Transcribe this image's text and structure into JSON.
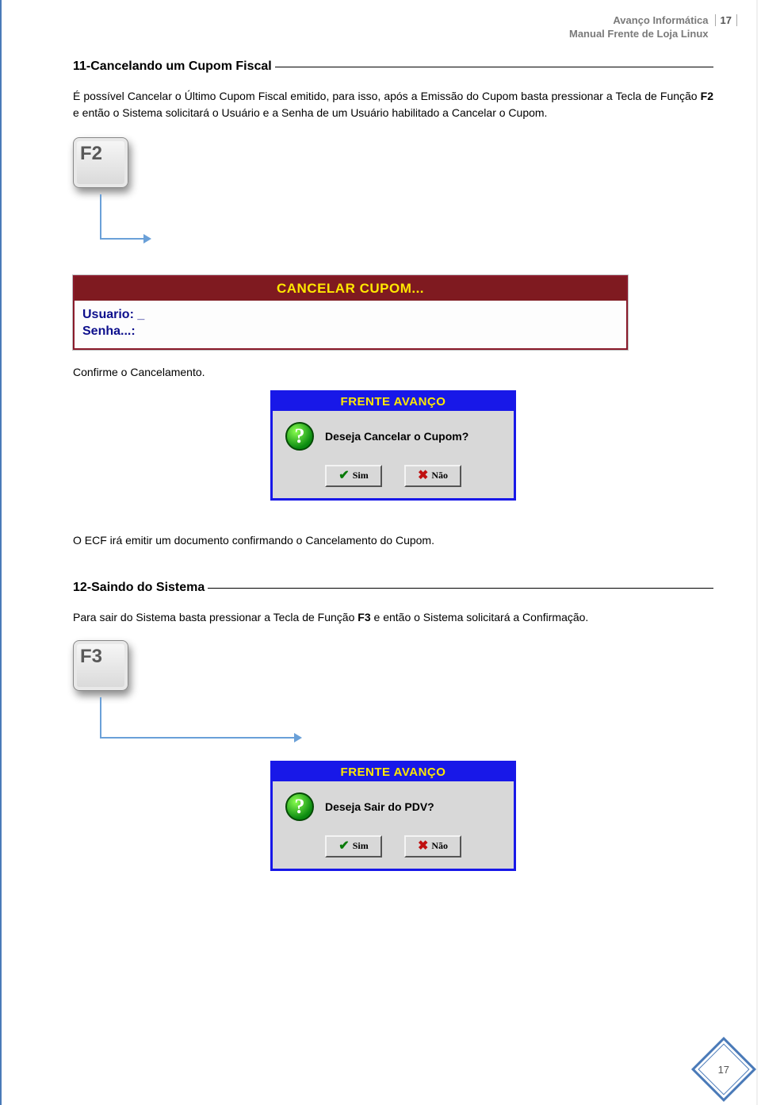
{
  "header": {
    "line1": "Avanço Informática",
    "line2": "Manual Frente de Loja Linux",
    "page_top": "17"
  },
  "section11": {
    "title": "11-Cancelando um Cupom Fiscal",
    "para1_a": "É possível Cancelar o Último Cupom Fiscal emitido, para isso, após a Emissão do Cupom basta pressionar a Tecla de Função ",
    "key_bold": "F2",
    "para1_b": " e então o Sistema solicitará o Usuário e a Senha de um Usuário habilitado a Cancelar o Cupom."
  },
  "fkey1": "F2",
  "cancel_window": {
    "title": "CANCELAR CUPOM...",
    "usuario_label": "Usuario:",
    "usuario_value": "_",
    "senha_label": "Senha...:"
  },
  "confirm_text": "Confirme o Cancelamento.",
  "dialog1": {
    "title": "FRENTE AVANÇO",
    "message": "Deseja Cancelar o Cupom?",
    "yes": "Sim",
    "no": "Não"
  },
  "ecf_text": "O ECF irá emitir um documento confirmando o Cancelamento do Cupom.",
  "section12": {
    "title": "12-Saindo do Sistema",
    "para_a": "Para sair do Sistema basta pressionar a Tecla de Função ",
    "key_bold": "F3",
    "para_b": " e então o Sistema solicitará a Confirmação."
  },
  "fkey2": "F3",
  "dialog2": {
    "title": "FRENTE AVANÇO",
    "message": "Deseja Sair do PDV?",
    "yes": "Sim",
    "no": "Não"
  },
  "footer_page": "17"
}
